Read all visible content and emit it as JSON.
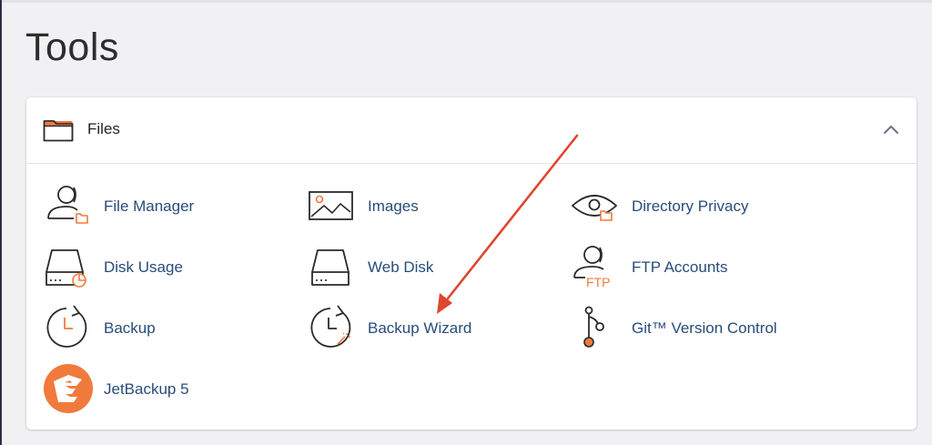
{
  "page": {
    "title": "Tools"
  },
  "panel": {
    "title": "Files",
    "items": [
      {
        "label": "File Manager",
        "icon": "file-manager-icon"
      },
      {
        "label": "Images",
        "icon": "images-icon"
      },
      {
        "label": "Directory Privacy",
        "icon": "directory-privacy-icon"
      },
      {
        "label": "Disk Usage",
        "icon": "disk-usage-icon"
      },
      {
        "label": "Web Disk",
        "icon": "web-disk-icon"
      },
      {
        "label": "FTP Accounts",
        "icon": "ftp-accounts-icon"
      },
      {
        "label": "Backup",
        "icon": "backup-icon"
      },
      {
        "label": "Backup Wizard",
        "icon": "backup-wizard-icon"
      },
      {
        "label": "Git™ Version Control",
        "icon": "git-icon"
      },
      {
        "label": "JetBackup 5",
        "icon": "jetbackup-icon"
      }
    ],
    "ftp_icon_text": "FTP"
  },
  "colors": {
    "accent": "#f07a3c",
    "link": "#284c7a",
    "icon_stroke": "#2a2a2a",
    "annotation_arrow": "#e0452f"
  }
}
